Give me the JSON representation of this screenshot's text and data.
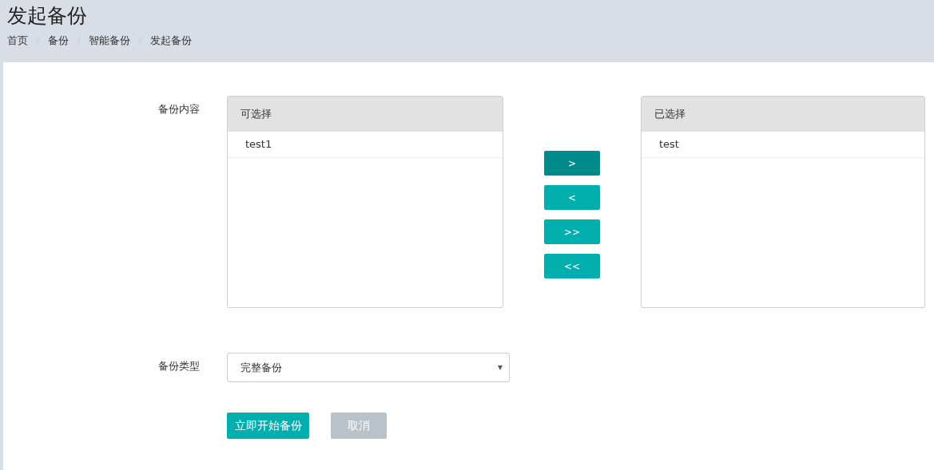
{
  "page_title": "发起备份",
  "breadcrumb": [
    {
      "label": "首页"
    },
    {
      "label": "备份"
    },
    {
      "label": "智能备份"
    },
    {
      "label": "发起备份"
    }
  ],
  "backup_content": {
    "label": "备份内容",
    "available": {
      "title": "可选择",
      "items": [
        {
          "label": "test1"
        }
      ]
    },
    "transfer_buttons": [
      {
        "label": ">",
        "active": true
      },
      {
        "label": "<",
        "active": false
      },
      {
        "label": ">>",
        "active": false
      },
      {
        "label": "<<",
        "active": false
      }
    ],
    "chosen": {
      "title": "已选择",
      "items": [
        {
          "label": "test"
        }
      ]
    }
  },
  "backup_type": {
    "label": "备份类型",
    "value": "完整备份"
  },
  "buttons": [
    {
      "label": "立即开始备份",
      "kind": "primary"
    },
    {
      "label": "取消",
      "kind": "secondary"
    }
  ]
}
